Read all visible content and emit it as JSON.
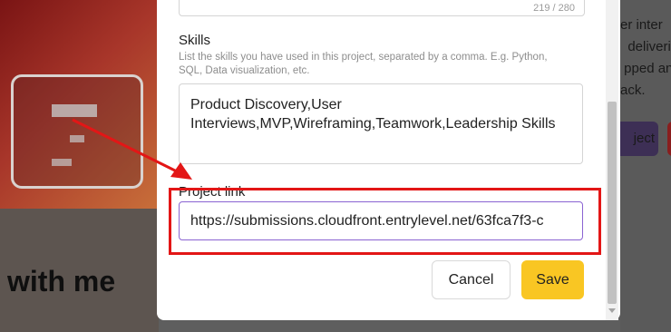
{
  "backdrop": {
    "heading": "with me",
    "right_text": "er inter\n  deliveri\n pped an\nack.",
    "right_button": "ject"
  },
  "previous_field": {
    "counter": "219 / 280"
  },
  "skills": {
    "label": "Skills",
    "help": "List the skills you have used in this project, separated by a comma. E.g. Python, SQL, Data visualization, etc.",
    "value": "Product Discovery,User Interviews,MVP,Wireframing,Teamwork,Leadership Skills"
  },
  "project_link": {
    "label": "Project link",
    "value": "https://submissions.cloudfront.entrylevel.net/63fca7f3-c"
  },
  "actions": {
    "cancel": "Cancel",
    "save": "Save"
  },
  "annotation": {
    "color": "#e31616",
    "accent": "#8a63d2",
    "save_color": "#f9c623"
  }
}
